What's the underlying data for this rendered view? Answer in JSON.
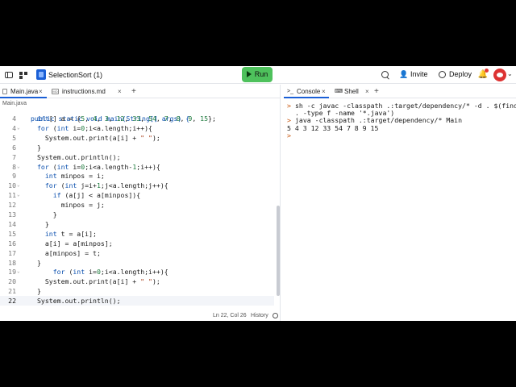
{
  "topbar": {
    "repl_name": "SelectionSort (1)",
    "run_label": "Run",
    "invite_label": "Invite",
    "deploy_label": "Deploy"
  },
  "editor": {
    "tabs": [
      {
        "label": "Main.java",
        "close": "×"
      },
      {
        "label": "instructions.md",
        "close": "×"
      }
    ],
    "add_tab": "+",
    "breadcrumb": "Main.java",
    "top_partial_line": "public static void main(String[] args) {",
    "lines": [
      {
        "num": "4",
        "fold": "",
        "code": "int[] a = {5, 4, 3, 12, 33, 54, 7, 8, 9, 15};"
      },
      {
        "num": "4",
        "fold": "⌄",
        "code": "for (int i=0;i<a.length;i++){"
      },
      {
        "num": "5",
        "fold": "",
        "code": "  System.out.print(a[i] + \" \");"
      },
      {
        "num": "6",
        "fold": "",
        "code": "}"
      },
      {
        "num": "7",
        "fold": "",
        "code": "System.out.println();"
      },
      {
        "num": "8",
        "fold": "⌄",
        "code": "for (int i=0;i<a.length-1;i++){"
      },
      {
        "num": "9",
        "fold": "",
        "code": "  int minpos = i;"
      },
      {
        "num": "10",
        "fold": "⌄",
        "code": "  for (int j=i+1;j<a.length;j++){"
      },
      {
        "num": "11",
        "fold": "⌄",
        "code": "    if (a[j] < a[minpos]){"
      },
      {
        "num": "12",
        "fold": "",
        "code": "      minpos = j;"
      },
      {
        "num": "13",
        "fold": "",
        "code": "    }"
      },
      {
        "num": "14",
        "fold": "",
        "code": "  }"
      },
      {
        "num": "15",
        "fold": "",
        "code": "  int t = a[i];"
      },
      {
        "num": "16",
        "fold": "",
        "code": "  a[i] = a[minpos];"
      },
      {
        "num": "17",
        "fold": "",
        "code": "  a[minpos] = t;"
      },
      {
        "num": "18",
        "fold": "",
        "code": "}"
      },
      {
        "num": "19",
        "fold": "⌄",
        "code": "    for (int i=0;i<a.length;i++){"
      },
      {
        "num": "20",
        "fold": "",
        "code": "  System.out.print(a[i] + \" \");"
      },
      {
        "num": "21",
        "fold": "",
        "code": "}"
      },
      {
        "num": "22",
        "fold": "",
        "code": "System.out.println();"
      }
    ],
    "status": {
      "cursor": "Ln 22, Col 26",
      "history": "History"
    }
  },
  "console": {
    "tabs": [
      {
        "label": "Console",
        "close": "×"
      },
      {
        "label": "Shell",
        "close": "×"
      }
    ],
    "add_tab": "+",
    "lines": [
      {
        "prompt": ">",
        "text": "sh -c javac -classpath .:target/dependency/* -d . $(find"
      },
      {
        "prompt": "",
        "text": ". -type f -name '*.java')"
      },
      {
        "prompt": ">",
        "text": "java -classpath .:target/dependency/* Main"
      },
      {
        "prompt": "",
        "text": "5 4 3 12 33 54 7 8 9 15",
        "output": true
      },
      {
        "prompt": ">",
        "text": ""
      }
    ]
  },
  "colors": {
    "accent": "#1a5fd6",
    "run_green": "#4ec15c",
    "keyword": "#0a4fae",
    "number": "#1c7a3c",
    "string": "#a3330c",
    "prompt": "#c8560d"
  }
}
